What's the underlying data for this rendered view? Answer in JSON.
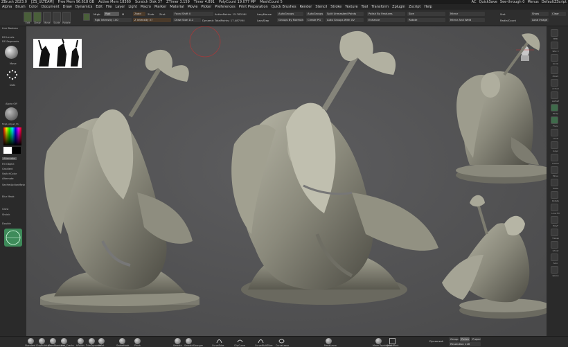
{
  "titlebar": {
    "items": [
      "ZBrush 2023.0",
      "[ZS_ULTEAM]",
      "Free Mem 96.618 GB",
      "Active Mem 18360",
      "Scratch Disk 37",
      "ZTimer 3.159",
      "Timer 4.891",
      "PolyCount 19.077 MP",
      "MeshCount 5"
    ],
    "right": [
      "AC",
      "QuickSave",
      "See-through 0",
      "Menus",
      "DefaultZScript"
    ]
  },
  "menubar": {
    "items": [
      "Alpha",
      "Brush",
      "Color",
      "Document",
      "Draw",
      "Dynamics",
      "Edit",
      "File",
      "Layer",
      "Light",
      "Macro",
      "Marker",
      "Material",
      "Movie",
      "Picker",
      "Preferences",
      "Print Preparation",
      "Quick Brushes",
      "Render",
      "Stencil",
      "Stroke",
      "Texture",
      "Tool",
      "Transform",
      "Zplugin",
      "Zscript",
      "Help"
    ]
  },
  "toolbar": {
    "buttons": [
      "Edit",
      "Draw",
      "Move",
      "Scale",
      "Rotate"
    ],
    "labels": {
      "mrgb": "Mrgb",
      "rgb": "Rgb",
      "m": "M",
      "zadd": "Zadd",
      "zsub": "Zsub",
      "zcut": "Zcut",
      "rgb_intensity": "Rgb Intensity 100",
      "z_intensity": "Z Intensity 37",
      "focal_shift": "Focal Shift 0",
      "draw_size": "Draw Size 112",
      "dynamic": "Dynamic",
      "active_points": "ActivePoints: 15.783 Mil",
      "total_points": "TotalPoints: 17.487 Mil",
      "lazymouse": "LazyMouse",
      "lazystep": "LazyStep",
      "autogroups": "AutoGroups",
      "groups_by_normals": "Groups By Normals",
      "split_unmasked": "Split Unmasked Points",
      "auto_groups_uv": "Auto Groups With UV",
      "create_pg": "Create PG",
      "polish_by_features": "Polish By Features",
      "enhance": "Enhance",
      "size": "Size",
      "rotate": "Rotate",
      "mirror": "Mirror",
      "mirror_and_weld": "Mirror And Weld",
      "smt": "Smt",
      "radial_count": "RadialCount",
      "show": "Show",
      "load_image": "Load Image",
      "clear": "Clear"
    }
  },
  "leftpanel": {
    "labels": [
      "Live Boolean",
      "DS Levels",
      "DS Segments",
      "Move",
      "Dots",
      "Alpha Off",
      "Texture Off",
      "Mrgb_Adjust_Sh",
      "Alternate",
      "Fill Object",
      "Gradient",
      "SwitchColor",
      "Alternate",
      "SecHetActionMask",
      "Blur Mask",
      "Grow",
      "Shrink",
      "Double"
    ]
  },
  "rightpanel": {
    "labels": [
      "BPR",
      "SPix 3",
      "Scroll",
      "Zoom",
      "Actual",
      "AAHalf",
      "Persp",
      "Floor",
      "Local",
      "Gxyz",
      "Frame",
      "Move",
      "Scale",
      "Rotate",
      "Line Fill",
      "PolyF",
      "Transp",
      "Ghost",
      "Solo",
      "Xpose"
    ]
  },
  "bottombar": {
    "brushes": [
      "Standard",
      "ClayBuildup",
      "DamStandard",
      "Orb_Cracks",
      "hPolish",
      "TrimDynamic",
      "Inflat",
      "SnakeHook",
      "Pinch",
      "Smooth",
      "SmoothStronger",
      "CurveTube",
      "ClipCurve",
      "CurveMultiTube",
      "CurveLasso",
      "MaskLasso",
      "Move Topological",
      "SelectRect"
    ],
    "right": [
      "Dynamesh",
      "Group",
      "Polish",
      "Project",
      "Resolution 128"
    ]
  },
  "colors": {
    "canvas": "#555556",
    "accent_green": "#3f6b4b",
    "ui_bg": "#2a2a2a"
  }
}
